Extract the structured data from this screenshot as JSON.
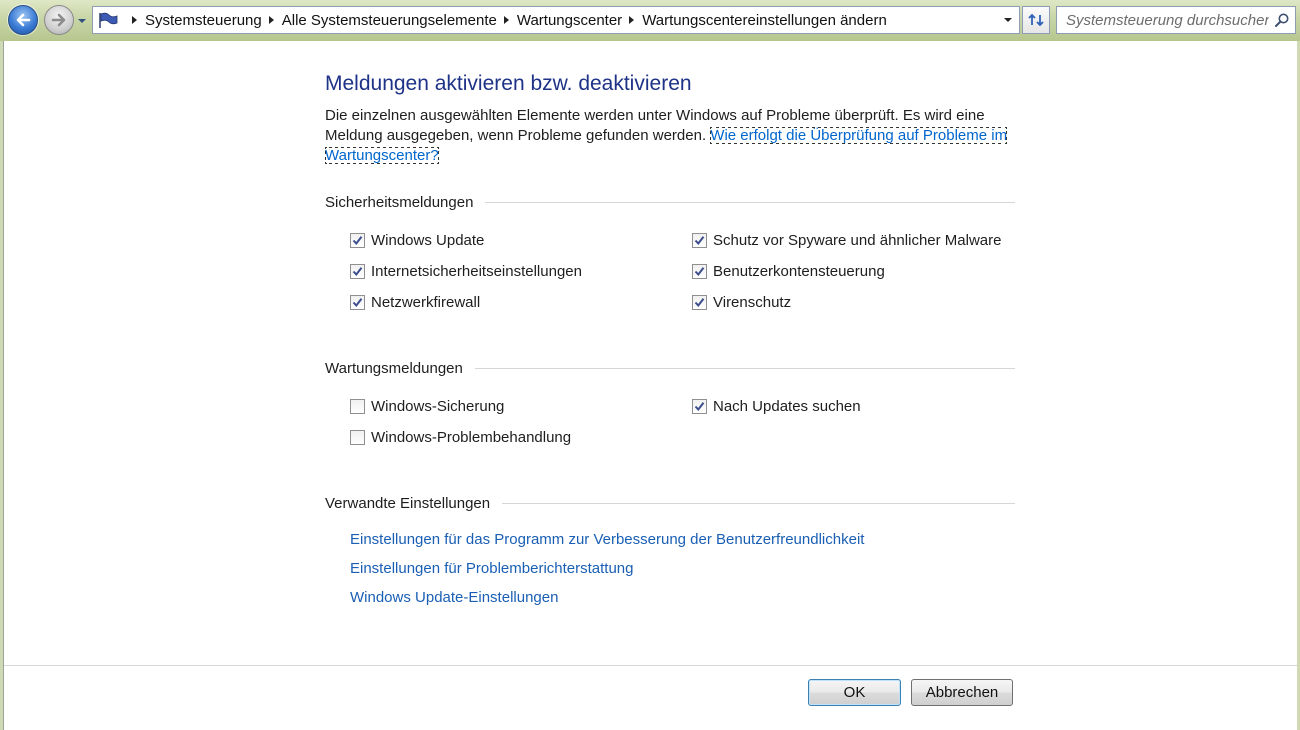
{
  "address_bar": {
    "breadcrumbs": [
      "Systemsteuerung",
      "Alle Systemsteuerungselemente",
      "Wartungscenter",
      "Wartungscentereinstellungen ändern"
    ]
  },
  "search": {
    "placeholder": "Systemsteuerung durchsuchen"
  },
  "page": {
    "title": "Meldungen aktivieren bzw. deaktivieren",
    "intro_text": "Die einzelnen ausgewählten Elemente werden unter Windows auf Probleme überprüft. Es wird eine Meldung ausgegeben, wenn Probleme gefunden werden. ",
    "intro_link": "Wie erfolgt die Überprüfung auf Probleme im Wartungscenter?"
  },
  "security": {
    "heading": "Sicherheitsmeldungen",
    "items": [
      {
        "label": "Windows Update",
        "checked": true
      },
      {
        "label": "Internetsicherheitseinstellungen",
        "checked": true
      },
      {
        "label": "Netzwerkfirewall",
        "checked": true
      },
      {
        "label": "Schutz vor Spyware und ähnlicher Malware",
        "checked": true
      },
      {
        "label": "Benutzerkontensteuerung",
        "checked": true
      },
      {
        "label": "Virenschutz",
        "checked": true
      }
    ]
  },
  "maintenance": {
    "heading": "Wartungsmeldungen",
    "items": [
      {
        "label": "Windows-Sicherung",
        "checked": false
      },
      {
        "label": "Windows-Problembehandlung",
        "checked": false
      },
      {
        "label": "Nach Updates suchen",
        "checked": true
      }
    ]
  },
  "related": {
    "heading": "Verwandte Einstellungen",
    "links": [
      "Einstellungen für das Programm zur Verbesserung der Benutzerfreundlichkeit",
      "Einstellungen für Problemberichterstattung",
      "Windows Update-Einstellungen"
    ]
  },
  "buttons": {
    "ok": "OK",
    "cancel": "Abbrechen"
  },
  "colors": {
    "title": "#1e3287",
    "link": "#1a5fb4",
    "checkmark": "#3b4d8c"
  },
  "icons": {
    "back": "back-arrow-icon",
    "forward": "forward-arrow-icon",
    "location": "action-center-flag-icon",
    "refresh": "refresh-icon",
    "search": "search-icon"
  }
}
